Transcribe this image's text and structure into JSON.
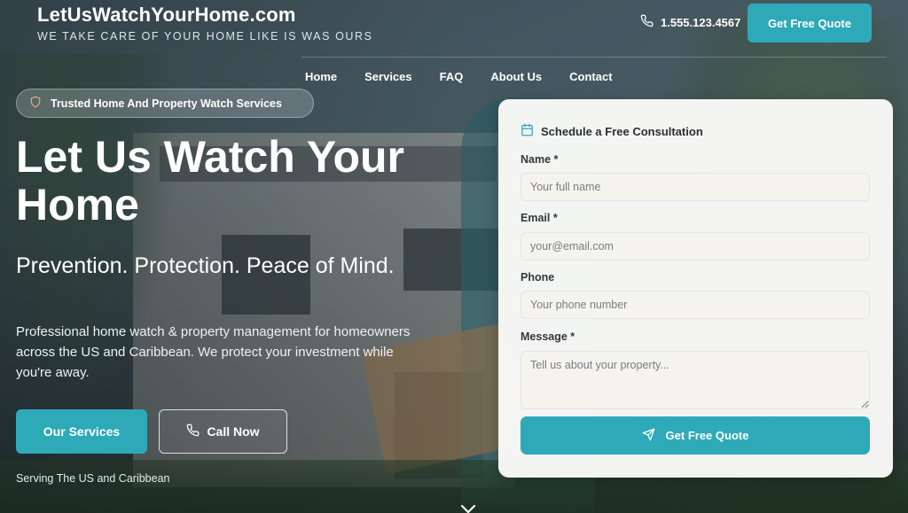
{
  "brand": {
    "name": "LetUsWatchYourHome.com",
    "tagline": "WE TAKE CARE OF YOUR HOME LIKE IS WAS OURS"
  },
  "header": {
    "phone": "1.555.123.4567",
    "phone_icon": "phone-icon",
    "quote_label": "Get Free Quote"
  },
  "nav": {
    "items": [
      {
        "label": "Home"
      },
      {
        "label": "Services"
      },
      {
        "label": "FAQ"
      },
      {
        "label": "About Us"
      },
      {
        "label": "Contact"
      }
    ]
  },
  "hero": {
    "badge": "Trusted Home And Property Watch Services",
    "badge_icon": "shield-icon",
    "title": "Let Us Watch Your Home",
    "subtitle": "Prevention. Protection. Peace of Mind.",
    "description": "Professional home watch & property management for homeowners across the US and Caribbean. We protect your investment while you're away.",
    "services_button": "Our Services",
    "call_button": "Call Now",
    "serving": "Serving The US and Caribbean"
  },
  "form": {
    "title": "Schedule a Free Consultation",
    "title_icon": "calendar-icon",
    "name_label": "Name *",
    "name_placeholder": "Your full name",
    "email_label": "Email *",
    "email_placeholder": "your@email.com",
    "phone_label": "Phone",
    "phone_placeholder": "Your phone number",
    "message_label": "Message *",
    "message_placeholder": "Tell us about your property...",
    "submit_label": "Get Free Quote",
    "submit_icon": "send-icon"
  },
  "colors": {
    "accent": "#2ea9b8",
    "card_bg": "#fafaf8"
  }
}
